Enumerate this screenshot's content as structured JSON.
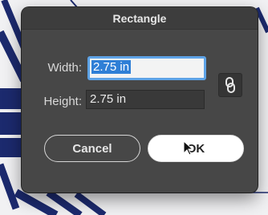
{
  "dialog": {
    "title": "Rectangle",
    "width_label": "Width:",
    "width_value": "2.75 in",
    "height_label": "Height:",
    "height_value": "2.75 in",
    "link_icon": "link-icon",
    "cancel_label": "Cancel",
    "ok_label": "OK"
  },
  "colors": {
    "dialog_bg": "#474747",
    "selection": "#2f7fd6",
    "focus_ring": "#5ea3e6",
    "artwork": "#1c2a6e"
  }
}
